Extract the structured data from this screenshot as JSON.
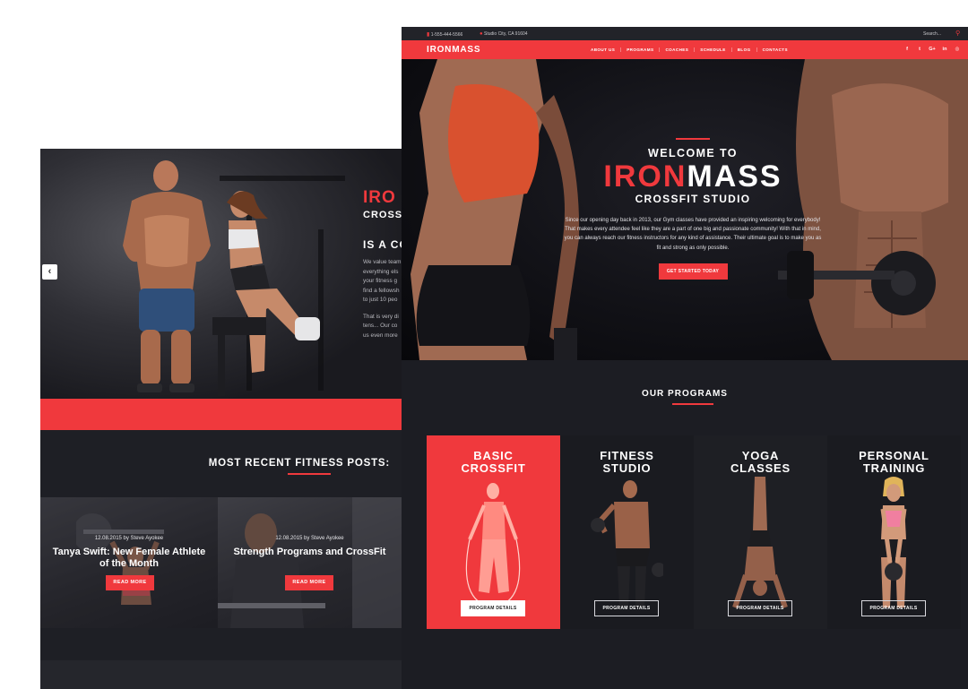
{
  "back_page": {
    "hero": {
      "title_red": "IRO",
      "title_white": "CROSSFI",
      "heading": "IS A CO",
      "paragraph_lines": [
        "We value team",
        "everything els",
        "your fitness g",
        "find a fellowsh",
        "to just 10 peo",
        "",
        "That is very di",
        "tens... Our co",
        "us even more"
      ],
      "prev_arrow": "‹"
    },
    "posts_section": {
      "title": "MOST RECENT FITNESS POSTS:",
      "posts": [
        {
          "meta": "12.08.2015 by Steve Ayokee",
          "title": "Tanya Swift: New Female Athlete of the Month",
          "button": "READ MORE"
        },
        {
          "meta": "12.08.2015 by Steve Ayokee",
          "title": "Strength Programs and CrossFit",
          "button": "READ MORE"
        }
      ]
    }
  },
  "front_page": {
    "topbar": {
      "phone": "1-555-444-5566",
      "address": "Studio City, CA 91604",
      "search_placeholder": "Search...",
      "phone_icon": "phone-icon",
      "location_icon": "map-pin-icon",
      "search_icon": "search-icon"
    },
    "navbar": {
      "logo": "IRONMASS",
      "items": [
        "ABOUT US",
        "PROGRAMS",
        "COACHES",
        "SCHEDULE",
        "BLOG",
        "CONTACTS"
      ],
      "social": [
        "f",
        "t",
        "G+",
        "in",
        "◎"
      ]
    },
    "hero": {
      "welcome": "WELCOME TO",
      "brand_red": "IRON",
      "brand_white": "MASS",
      "subtitle": "CROSSFIT STUDIO",
      "paragraph": "Since our opening day back in 2013, our Gym classes have provided an inspiring welcoming for everybody! That makes every attendee feel like they are a part of one big and passionate community! With that in mind, you can always reach our fitness instructors for any kind of assistance. Their ultimate goal is to make you as fit and strong as only possible.",
      "cta": "GET STARTED TODAY"
    },
    "programs": {
      "title": "OUR PROGRAMS",
      "cards": [
        {
          "title_line1": "BASIC",
          "title_line2": "CROSSFIT",
          "button": "PROGRAM DETAILS"
        },
        {
          "title_line1": "FITNESS",
          "title_line2": "STUDIO",
          "button": "PROGRAM DETAILS"
        },
        {
          "title_line1": "YOGA",
          "title_line2": "CLASSES",
          "button": "PROGRAM DETAILS"
        },
        {
          "title_line1": "PERSONAL",
          "title_line2": "TRAINING",
          "button": "PROGRAM DETAILS"
        }
      ]
    }
  },
  "colors": {
    "accent": "#f0393d",
    "dark_bg": "#1c1d23",
    "text": "#ffffff"
  }
}
